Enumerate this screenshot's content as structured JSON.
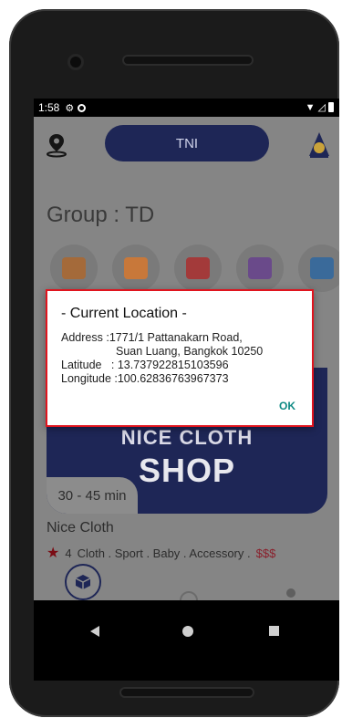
{
  "status_bar": {
    "time": "1:58"
  },
  "header": {
    "center_label": "TNI"
  },
  "group": {
    "title": "Group : TD"
  },
  "categories": [
    {
      "icon": "clothing-icon",
      "color": "#a46a3a"
    },
    {
      "icon": "shoes-bag-icon",
      "color": "#c8783a"
    },
    {
      "icon": "cabinet-icon",
      "color": "#a33a3a"
    },
    {
      "icon": "baby-onesie-icon",
      "color": "#6a4a8a"
    },
    {
      "icon": "accessory-icon",
      "color": "#3a6a9a"
    }
  ],
  "banner": {
    "line1": "NICE CLOTH",
    "line2": "SHOP"
  },
  "shop": {
    "delivery_time": "30 - 45 min",
    "name": "Nice Cloth",
    "rating": "4",
    "tags": "Cloth . Sport . Baby . Accessory .",
    "price": "$$$"
  },
  "dialog": {
    "title": "- Current Location -",
    "address_label": "Address : ",
    "address_line1": "1771/1 Pattanakarn Road,",
    "address_line2": "Suan Luang, Bangkok 10250",
    "latitude_label": "Latitude   : ",
    "latitude": "13.737922815103596",
    "longitude_label": "Longitude : ",
    "longitude": "100.62836763967373",
    "ok_label": "OK"
  },
  "colors": {
    "brand_navy": "#1e2656",
    "dialog_border": "#e0141e",
    "ok_teal": "#0f8a84",
    "price_red": "#8a1f2b"
  }
}
